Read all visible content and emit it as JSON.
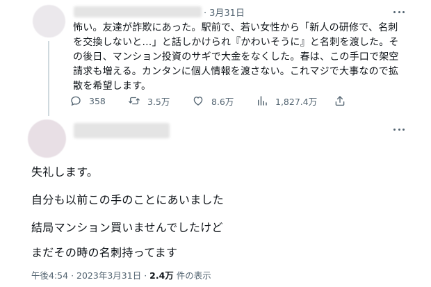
{
  "tweet": {
    "date": "3月31日",
    "separator": "·",
    "lines": [
      "怖い。友達が詐欺にあった。駅前で、若い女性から「新人の研修で、名刺",
      "を交換しないと…」と話しかけられ『かわいそうに』と名刺を渡した。そ",
      "の後日、マンション投資のサギで大金をなくした。春は、この手口で架空",
      "請求も増える。カンタンに個人情報を渡さない。これマジで大事なので拡",
      "散を希望します。"
    ],
    "actions": {
      "replies": "358",
      "retweets": "3.5万",
      "likes": "8.6万",
      "views": "1,827.4万"
    }
  },
  "reply": {
    "lines": [
      "失礼します。",
      "自分も以前この手のことにあいました",
      "結局マンション買いませんでしたけど",
      "まだその時の名刺持ってます"
    ],
    "time": "午後4:54",
    "sep1": "·",
    "date": "2023年3月31日",
    "sep2": "·",
    "views_count": "2.4万",
    "views_label": "件の表示"
  },
  "icons": {
    "reply": "reply-icon",
    "retweet": "retweet-icon",
    "like": "heart-icon",
    "views": "views-icon",
    "share": "share-icon",
    "more": "more-icon"
  },
  "colors": {
    "text": "#0f1419",
    "muted": "#536471",
    "thread_line": "#cfd9de"
  }
}
